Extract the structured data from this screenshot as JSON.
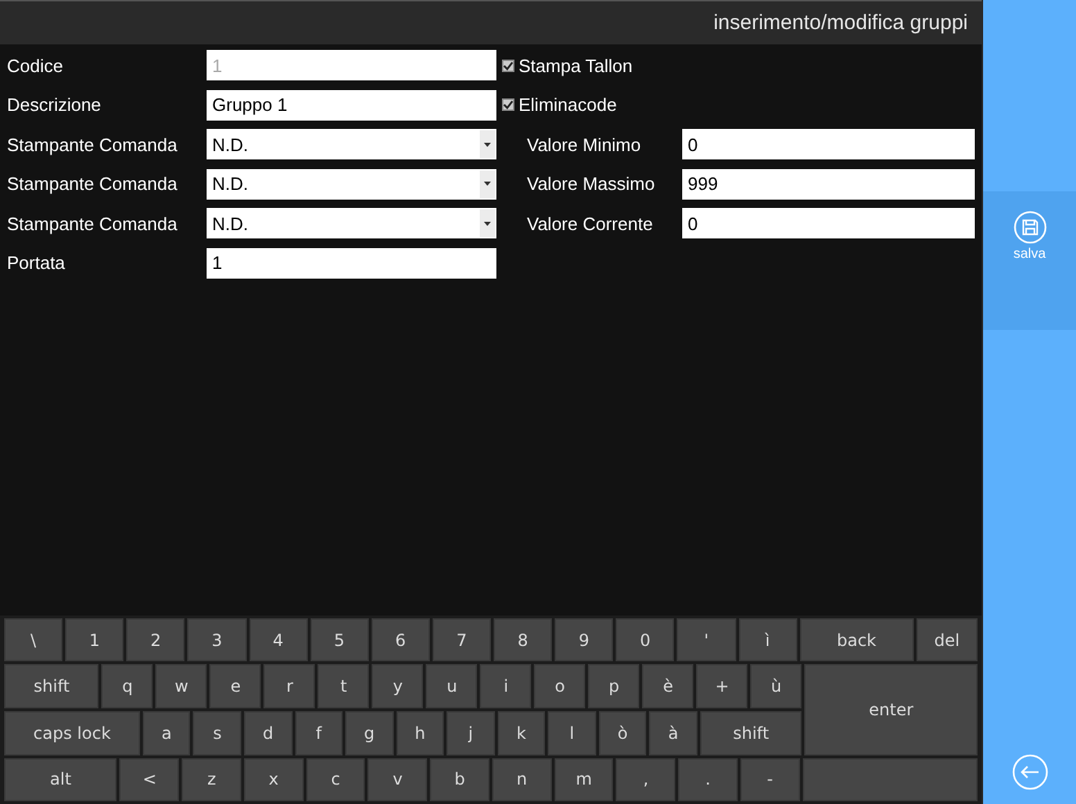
{
  "header": {
    "title": "inserimento/modifica gruppi"
  },
  "form": {
    "fields": [
      {
        "label": "Codice",
        "kind": "text",
        "value": "1",
        "disabled": true
      },
      {
        "label": "Descrizione",
        "kind": "text",
        "value": "Gruppo 1",
        "disabled": false
      },
      {
        "label": "Stampante Comanda",
        "kind": "select",
        "value": "N.D.",
        "disabled": false
      },
      {
        "label": "Stampante Comanda",
        "kind": "select",
        "value": "N.D.",
        "disabled": false
      },
      {
        "label": "Stampante Comanda",
        "kind": "select",
        "value": "N.D.",
        "disabled": false
      },
      {
        "label": "Portata",
        "kind": "text",
        "value": "1",
        "disabled": false
      }
    ],
    "checkboxes": [
      {
        "label": "Stampa Tallon",
        "checked": true
      },
      {
        "label": "Eliminacode",
        "checked": true
      }
    ],
    "values": [
      {
        "label": "Valore Minimo",
        "value": "0"
      },
      {
        "label": "Valore Massimo",
        "value": "999"
      },
      {
        "label": "Valore Corrente",
        "value": "0"
      }
    ]
  },
  "keyboard": {
    "rows": [
      {
        "keys": [
          {
            "label": "\\",
            "kind": "char"
          },
          {
            "label": "1",
            "kind": "char"
          },
          {
            "label": "2",
            "kind": "char"
          },
          {
            "label": "3",
            "kind": "char"
          },
          {
            "label": "4",
            "kind": "char"
          },
          {
            "label": "5",
            "kind": "char"
          },
          {
            "label": "6",
            "kind": "char"
          },
          {
            "label": "7",
            "kind": "char"
          },
          {
            "label": "8",
            "kind": "char"
          },
          {
            "label": "9",
            "kind": "char"
          },
          {
            "label": "0",
            "kind": "char"
          },
          {
            "label": "'",
            "kind": "char"
          },
          {
            "label": "ì",
            "kind": "char"
          },
          {
            "label": "back",
            "kind": "back"
          },
          {
            "label": "del",
            "kind": "del"
          }
        ]
      },
      {
        "keys": [
          {
            "label": "shift",
            "kind": "shift"
          },
          {
            "label": "q",
            "kind": "char"
          },
          {
            "label": "w",
            "kind": "char"
          },
          {
            "label": "e",
            "kind": "char"
          },
          {
            "label": "r",
            "kind": "char"
          },
          {
            "label": "t",
            "kind": "char"
          },
          {
            "label": "y",
            "kind": "char"
          },
          {
            "label": "u",
            "kind": "char"
          },
          {
            "label": "i",
            "kind": "char"
          },
          {
            "label": "o",
            "kind": "char"
          },
          {
            "label": "p",
            "kind": "char"
          },
          {
            "label": "è",
            "kind": "char"
          },
          {
            "label": "+",
            "kind": "char"
          },
          {
            "label": "ù",
            "kind": "char"
          }
        ]
      },
      {
        "keys": [
          {
            "label": "caps lock",
            "kind": "caps"
          },
          {
            "label": "a",
            "kind": "char"
          },
          {
            "label": "s",
            "kind": "char"
          },
          {
            "label": "d",
            "kind": "char"
          },
          {
            "label": "f",
            "kind": "char"
          },
          {
            "label": "g",
            "kind": "char"
          },
          {
            "label": "h",
            "kind": "char"
          },
          {
            "label": "j",
            "kind": "char"
          },
          {
            "label": "k",
            "kind": "char"
          },
          {
            "label": "l",
            "kind": "char"
          },
          {
            "label": "ò",
            "kind": "char"
          },
          {
            "label": "à",
            "kind": "char"
          },
          {
            "label": "shift",
            "kind": "shift2"
          }
        ]
      },
      {
        "keys": [
          {
            "label": "alt",
            "kind": "alt"
          },
          {
            "label": "<",
            "kind": "char"
          },
          {
            "label": "z",
            "kind": "char"
          },
          {
            "label": "x",
            "kind": "char"
          },
          {
            "label": "c",
            "kind": "char"
          },
          {
            "label": "v",
            "kind": "char"
          },
          {
            "label": "b",
            "kind": "char"
          },
          {
            "label": "n",
            "kind": "char"
          },
          {
            "label": "m",
            "kind": "char"
          },
          {
            "label": ",",
            "kind": "char"
          },
          {
            "label": ".",
            "kind": "char"
          },
          {
            "label": "-",
            "kind": "char"
          }
        ]
      }
    ],
    "enter": "enter"
  },
  "sidebar": {
    "actions": [
      {
        "label": "salva"
      }
    ]
  }
}
